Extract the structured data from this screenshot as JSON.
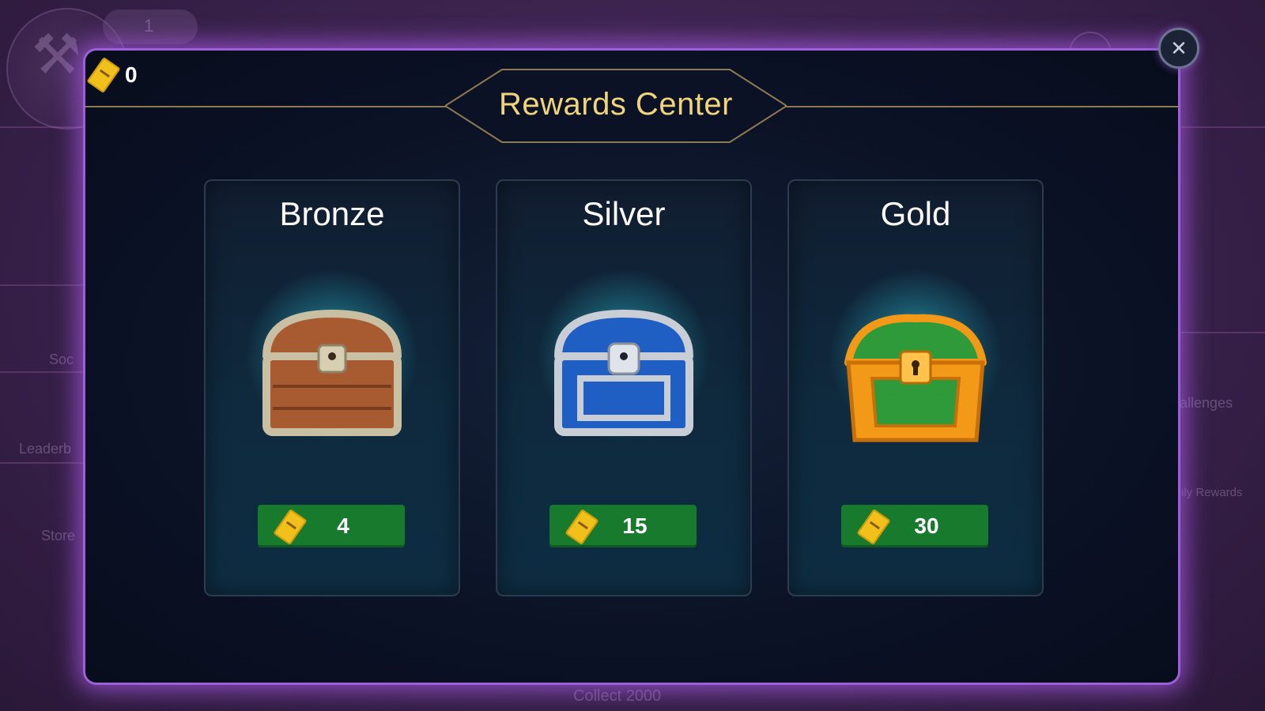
{
  "background": {
    "level_number": "1",
    "side_labels": [
      "Soc",
      "Leaderb",
      "Store",
      "allenges",
      "ily Rewards"
    ],
    "bottom_text": "Collect 2000"
  },
  "modal": {
    "title": "Rewards Center",
    "ticket_balance": "0",
    "close_icon": "close-icon",
    "accent_color": "#9b5fd6",
    "title_color": "#f0d47a"
  },
  "chests": [
    {
      "tier": "Bronze",
      "price": "4",
      "color": "#a85a30",
      "trim": "#c9bfa3"
    },
    {
      "tier": "Silver",
      "price": "15",
      "color": "#1f5fc4",
      "trim": "#c8cdd6"
    },
    {
      "tier": "Gold",
      "price": "30",
      "color": "#2f9a3a",
      "trim": "#f29a17"
    }
  ],
  "colors": {
    "price_button": "#177a2c",
    "ticket": "#f2c01b"
  }
}
